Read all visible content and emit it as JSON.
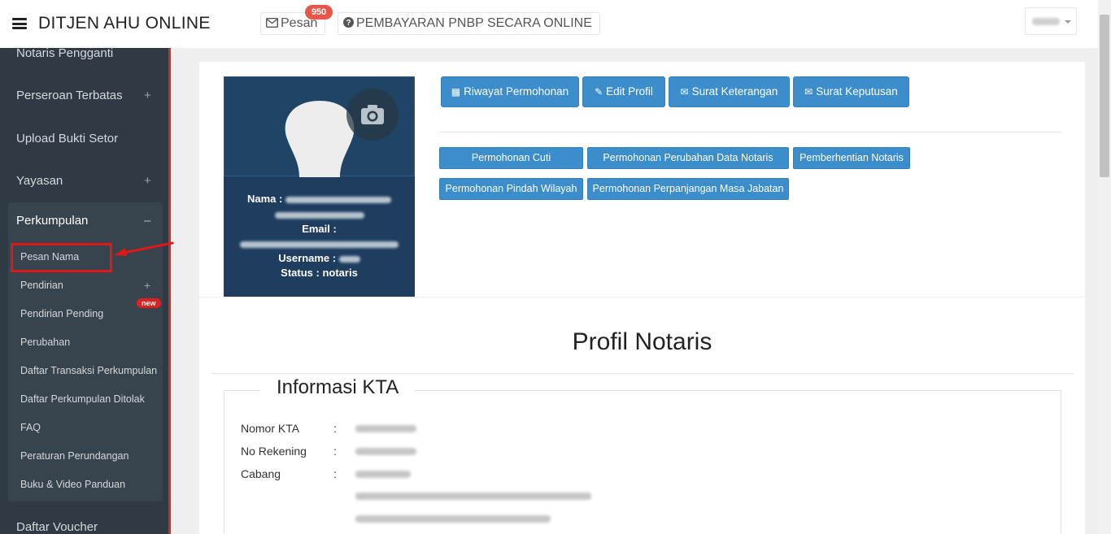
{
  "header": {
    "brand": "DITJEN AHU ONLINE",
    "pesan_label": "Pesan",
    "pesan_count": "950",
    "pnbp_label": "PEMBAYARAN PNBP SECARA ONLINE"
  },
  "sidebar": {
    "items": [
      {
        "label": "Notaris Pengganti"
      },
      {
        "label": "Perseroan Terbatas",
        "toggle": "+"
      },
      {
        "label": "Upload Bukti Setor"
      },
      {
        "label": "Yayasan",
        "toggle": "+"
      },
      {
        "label": "Daftar Voucher"
      }
    ],
    "submenu": {
      "title": "Perkumpulan",
      "toggle": "–",
      "items": [
        {
          "label": "Pesan Nama"
        },
        {
          "label": "Pendirian",
          "toggle": "+"
        },
        {
          "label": "Pendirian Pending",
          "badge": "new"
        },
        {
          "label": "Perubahan"
        },
        {
          "label": "Daftar Transaksi Perkumpulan"
        },
        {
          "label": "Daftar Perkumpulan Ditolak"
        },
        {
          "label": "FAQ"
        },
        {
          "label": "Peraturan Perundangan"
        },
        {
          "label": "Buku & Video Panduan"
        }
      ]
    }
  },
  "profile": {
    "nama_label": "Nama :",
    "email_label": "Email :",
    "username_label": "Username :",
    "status_label": "Status :",
    "status_value": "notaris"
  },
  "actions": {
    "primary": [
      "Riwayat Permohonan",
      "Edit Profil",
      "Surat Keterangan",
      "Surat Keputusan"
    ],
    "secondary": [
      "Permohonan Cuti",
      "Permohonan Perubahan Data Notaris",
      "Pemberhentian Notaris",
      "Permohonan Pindah Wilayah",
      "Permohonan Perpanjangan Masa Jabatan"
    ]
  },
  "main": {
    "title": "Profil Notaris",
    "section_title": "Informasi KTA",
    "fields": [
      {
        "label": "Nomor KTA",
        "colon": ":"
      },
      {
        "label": "No Rekening",
        "colon": ":"
      },
      {
        "label": "Cabang",
        "colon": ":"
      }
    ]
  },
  "colors": {
    "primary_button": "#3c8dcc",
    "sidebar_bg": "#2f3a44",
    "highlight": "#e01818"
  }
}
